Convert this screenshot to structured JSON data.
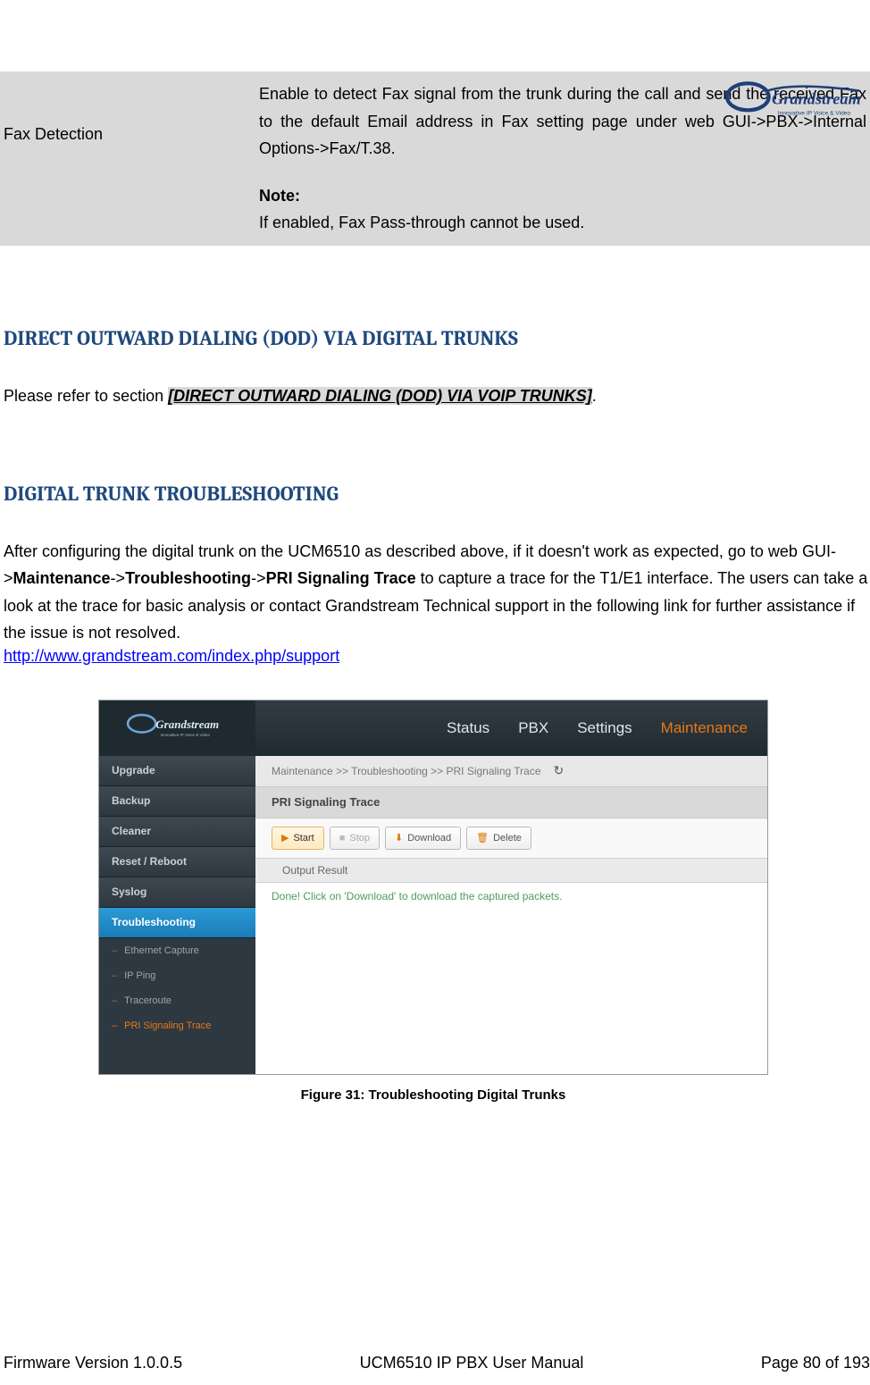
{
  "logo": {
    "brand": "Grandstream",
    "tagline": "Innovative IP Voice & Video"
  },
  "table": {
    "left": "Fax Detection",
    "right_p1": "Enable to detect Fax signal from the trunk during the call and send the received Fax to the default Email address in Fax setting page under web GUI->PBX->Internal Options->Fax/T.38.",
    "note_label": "Note:",
    "note_body": "If enabled, Fax Pass-through cannot be used."
  },
  "heading1": "DIRECT OUTWARD DIALING (DOD) VIA DIGITAL TRUNKS",
  "p1_prefix": "Please refer to section ",
  "p1_link": "[DIRECT OUTWARD DIALING (DOD) VIA VOIP TRUNKS]",
  "p1_suffix": ".",
  "heading2": "DIGITAL TRUNK TROUBLESHOOTING",
  "p2_a": "After configuring the digital trunk on the UCM6510 as described above, if it doesn't work as expected, go to web GUI->",
  "p2_b": "Maintenance",
  "p2_c": "->",
  "p2_d": "Troubleshooting",
  "p2_e": "->",
  "p2_f": "PRI Signaling Trace",
  "p2_g": " to capture a trace for the T1/E1 interface. The users can take a look at the trace for basic analysis or contact Grandstream Technical support in the following link for further assistance if the issue is not resolved.",
  "url": "http://www.grandstream.com/index.php/support",
  "screenshot": {
    "topnav": [
      "Status",
      "PBX",
      "Settings",
      "Maintenance"
    ],
    "topnav_active": 3,
    "sidebar": [
      "Upgrade",
      "Backup",
      "Cleaner",
      "Reset / Reboot",
      "Syslog",
      "Troubleshooting"
    ],
    "sidebar_active": 5,
    "subitems": [
      "Ethernet Capture",
      "IP Ping",
      "Traceroute",
      "PRI Signaling Trace"
    ],
    "subitem_active": 3,
    "breadcrumb": "Maintenance >> Troubleshooting >> PRI Signaling Trace",
    "panel_title": "PRI Signaling Trace",
    "buttons": {
      "start": "Start",
      "stop": "Stop",
      "download": "Download",
      "delete": "Delete"
    },
    "output_header": "Output Result",
    "output_body": "Done! Click on 'Download' to download the captured packets."
  },
  "figure_caption": "Figure 31: Troubleshooting Digital Trunks",
  "footer": {
    "left": "Firmware Version 1.0.0.5",
    "center": "UCM6510 IP PBX User Manual",
    "right": "Page 80 of 193"
  }
}
